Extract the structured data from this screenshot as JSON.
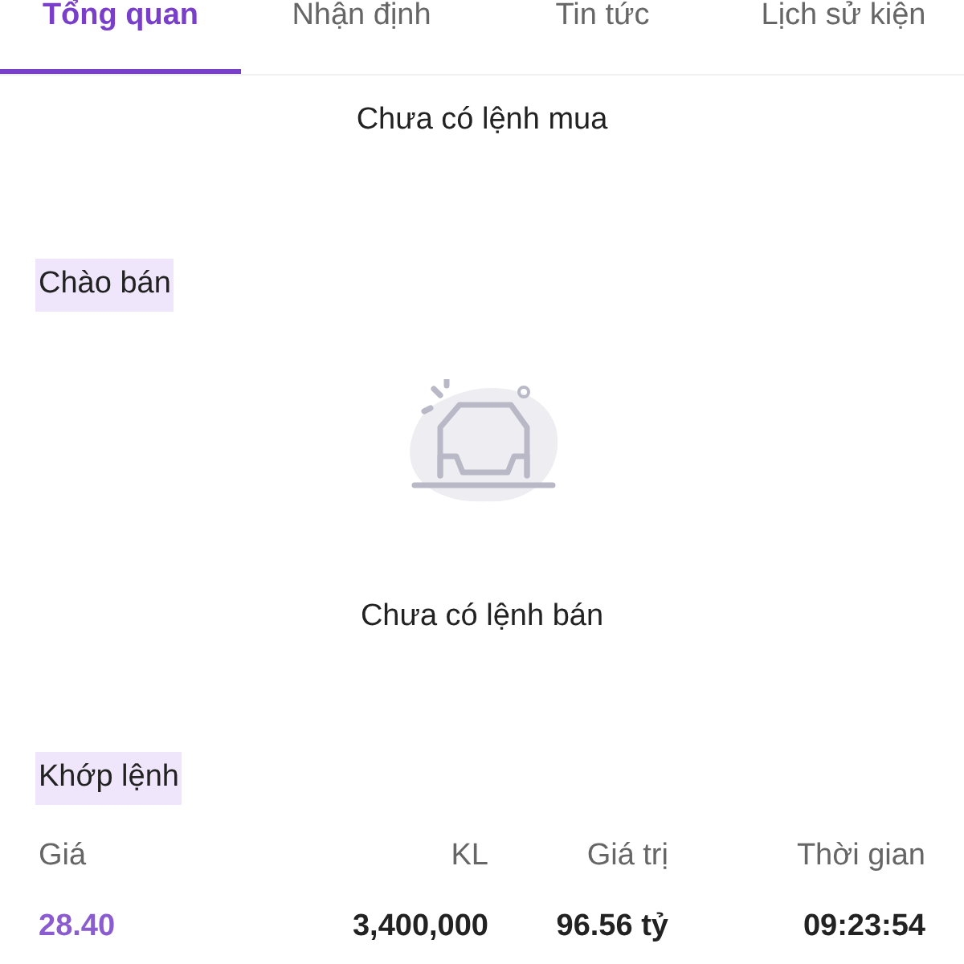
{
  "tabs": [
    {
      "label": "Tổng quan",
      "selected": true
    },
    {
      "label": "Nhận định",
      "selected": false
    },
    {
      "label": "Tin tức",
      "selected": false
    },
    {
      "label": "Lịch sử kiện",
      "selected": false
    }
  ],
  "buy_orders": {
    "empty_text": "Chưa có lệnh mua"
  },
  "sell_orders": {
    "title": "Chào bán",
    "empty_text": "Chưa có lệnh bán"
  },
  "matched": {
    "title": "Khớp lệnh",
    "columns": [
      "Giá",
      "KL",
      "Giá trị",
      "Thời gian"
    ],
    "rows": [
      {
        "price": "28.40",
        "volume": "3,400,000",
        "value": "96.56 tỷ",
        "time": "09:23:54"
      }
    ]
  }
}
